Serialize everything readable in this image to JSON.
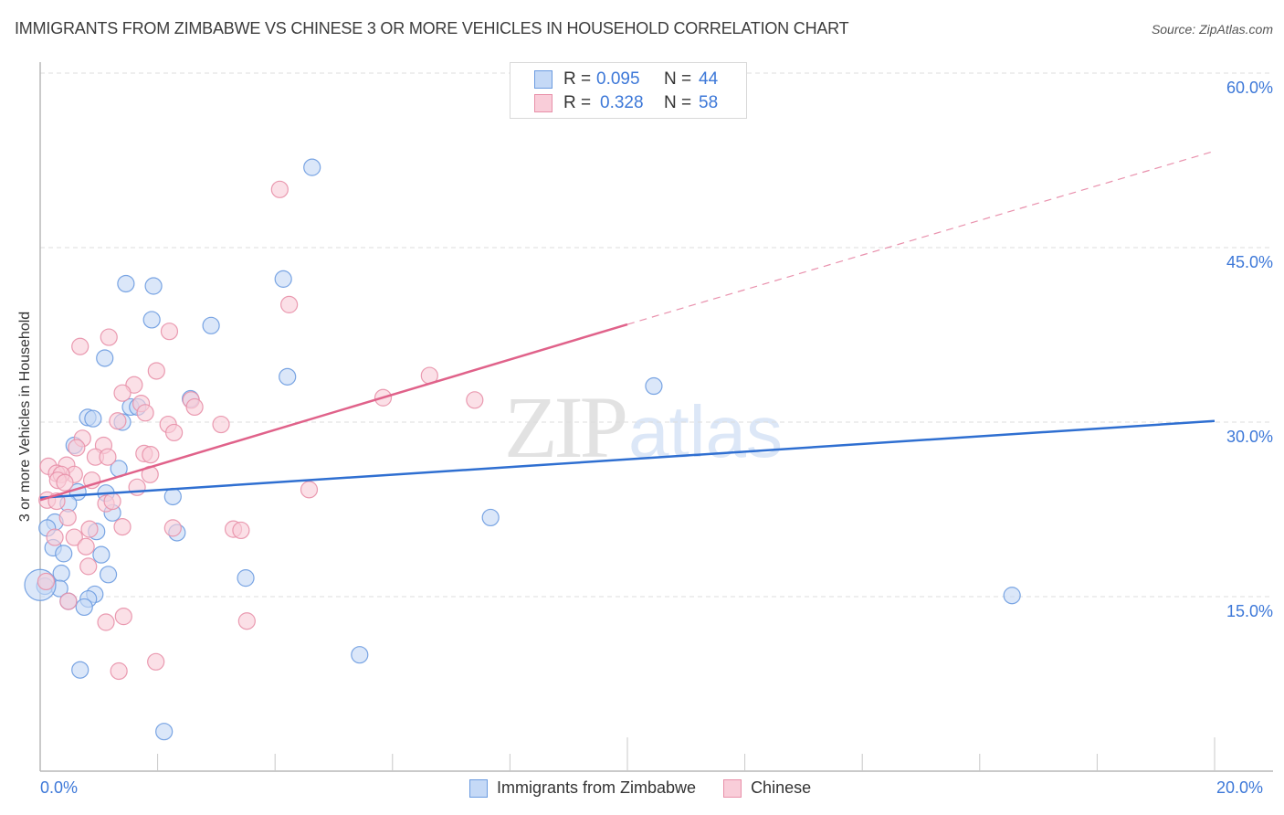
{
  "header": {
    "title": "IMMIGRANTS FROM ZIMBABWE VS CHINESE 3 OR MORE VEHICLES IN HOUSEHOLD CORRELATION CHART",
    "source": "Source: ZipAtlas.com"
  },
  "watermark": {
    "zip": "ZIP",
    "atlas": "atlas"
  },
  "legend": {
    "rows": [
      {
        "series": "Immigrants from Zimbabwe",
        "r_label": "R =",
        "r_value": "0.095",
        "n_label": "N =",
        "n_value": "44"
      },
      {
        "series": "Chinese",
        "r_label": "R =",
        "r_value": "0.328",
        "n_label": "N =",
        "n_value": "58"
      }
    ]
  },
  "colors": {
    "blue_fill": "#c5d9f6",
    "blue_stroke": "#6b9be0",
    "blue_line": "#2f6fd1",
    "pink_fill": "#f9cdd9",
    "pink_stroke": "#e890a9",
    "pink_line": "#e0628a",
    "tick_text": "#3d78d8"
  },
  "chart_data": {
    "type": "scatter",
    "title": "IMMIGRANTS FROM ZIMBABWE VS CHINESE 3 OR MORE VEHICLES IN HOUSEHOLD CORRELATION CHART",
    "xlabel": "",
    "ylabel": "3 or more Vehicles in Household",
    "xlim": [
      0,
      20
    ],
    "ylim": [
      0,
      62
    ],
    "x_tick_labels": [
      "0.0%",
      "20.0%"
    ],
    "y_ticks": [
      15,
      30,
      45,
      60
    ],
    "y_tick_labels": [
      "15.0%",
      "30.0%",
      "45.0%",
      "60.0%"
    ],
    "grid": "horizontal-dashed",
    "legend_placement": "top-center",
    "series": [
      {
        "name": "Immigrants from Zimbabwe",
        "color": "blue",
        "R": 0.095,
        "N": 44,
        "trend": {
          "x0": 0,
          "y0": 23.5,
          "x1": 20,
          "y1": 30.1,
          "dashed_from": null
        },
        "points": [
          [
            4.63,
            51.9
          ],
          [
            4.14,
            42.3
          ],
          [
            1.46,
            41.9
          ],
          [
            1.93,
            41.7
          ],
          [
            1.9,
            38.8
          ],
          [
            2.91,
            38.3
          ],
          [
            1.1,
            35.5
          ],
          [
            4.21,
            33.9
          ],
          [
            10.45,
            33.1
          ],
          [
            2.56,
            32.0
          ],
          [
            1.54,
            31.3
          ],
          [
            1.66,
            31.3
          ],
          [
            0.81,
            30.4
          ],
          [
            0.9,
            30.3
          ],
          [
            1.4,
            30.0
          ],
          [
            0.58,
            28.0
          ],
          [
            1.34,
            26.0
          ],
          [
            0.64,
            24.0
          ],
          [
            1.12,
            23.9
          ],
          [
            2.26,
            23.6
          ],
          [
            0.48,
            23.0
          ],
          [
            7.67,
            21.8
          ],
          [
            0.25,
            21.4
          ],
          [
            1.23,
            22.2
          ],
          [
            2.33,
            20.5
          ],
          [
            0.12,
            20.9
          ],
          [
            0.96,
            20.6
          ],
          [
            0.22,
            19.2
          ],
          [
            0.4,
            18.7
          ],
          [
            1.04,
            18.6
          ],
          [
            3.5,
            16.6
          ],
          [
            1.16,
            16.9
          ],
          [
            0.36,
            17.0
          ],
          [
            0.08,
            15.9
          ],
          [
            0.33,
            15.7
          ],
          [
            0.93,
            15.2
          ],
          [
            0.82,
            14.8
          ],
          [
            16.55,
            15.1
          ],
          [
            0.75,
            14.1
          ],
          [
            0.48,
            14.6
          ],
          [
            5.44,
            10.0
          ],
          [
            0.68,
            8.7
          ],
          [
            2.11,
            3.4
          ],
          [
            0.0,
            16.0
          ]
        ]
      },
      {
        "name": "Chinese",
        "color": "pink",
        "R": 0.328,
        "N": 58,
        "trend": {
          "x0": 0,
          "y0": 23.3,
          "x1": 10,
          "y1": 38.4,
          "dashed_to_x": 20,
          "dashed_to_y": 53.3
        },
        "points": [
          [
            4.08,
            50.0
          ],
          [
            4.24,
            40.1
          ],
          [
            0.68,
            36.5
          ],
          [
            1.17,
            37.3
          ],
          [
            2.2,
            37.8
          ],
          [
            1.98,
            34.4
          ],
          [
            6.63,
            34.0
          ],
          [
            1.6,
            33.2
          ],
          [
            1.4,
            32.5
          ],
          [
            2.57,
            31.9
          ],
          [
            5.84,
            32.1
          ],
          [
            1.72,
            31.6
          ],
          [
            2.63,
            31.3
          ],
          [
            1.79,
            30.8
          ],
          [
            1.32,
            30.1
          ],
          [
            2.18,
            29.8
          ],
          [
            3.08,
            29.8
          ],
          [
            2.28,
            29.1
          ],
          [
            0.72,
            28.6
          ],
          [
            0.62,
            27.8
          ],
          [
            1.08,
            28.0
          ],
          [
            1.77,
            27.3
          ],
          [
            1.88,
            27.2
          ],
          [
            0.94,
            27.0
          ],
          [
            1.15,
            27.0
          ],
          [
            0.45,
            26.3
          ],
          [
            0.14,
            26.2
          ],
          [
            0.28,
            25.6
          ],
          [
            0.58,
            25.5
          ],
          [
            0.36,
            25.5
          ],
          [
            0.88,
            25.0
          ],
          [
            1.87,
            25.5
          ],
          [
            0.3,
            25.0
          ],
          [
            0.42,
            24.8
          ],
          [
            1.65,
            24.4
          ],
          [
            4.58,
            24.2
          ],
          [
            0.12,
            23.3
          ],
          [
            0.28,
            23.2
          ],
          [
            1.12,
            23.0
          ],
          [
            1.23,
            23.2
          ],
          [
            0.47,
            21.8
          ],
          [
            0.84,
            20.8
          ],
          [
            1.4,
            21.0
          ],
          [
            2.26,
            20.9
          ],
          [
            3.29,
            20.8
          ],
          [
            3.42,
            20.7
          ],
          [
            0.58,
            20.1
          ],
          [
            0.78,
            19.3
          ],
          [
            0.82,
            17.6
          ],
          [
            0.1,
            16.3
          ],
          [
            0.48,
            14.6
          ],
          [
            1.42,
            13.3
          ],
          [
            3.52,
            12.9
          ],
          [
            1.12,
            12.8
          ],
          [
            1.97,
            9.4
          ],
          [
            1.34,
            8.6
          ],
          [
            0.25,
            20.1
          ],
          [
            7.4,
            31.9
          ]
        ]
      }
    ]
  }
}
